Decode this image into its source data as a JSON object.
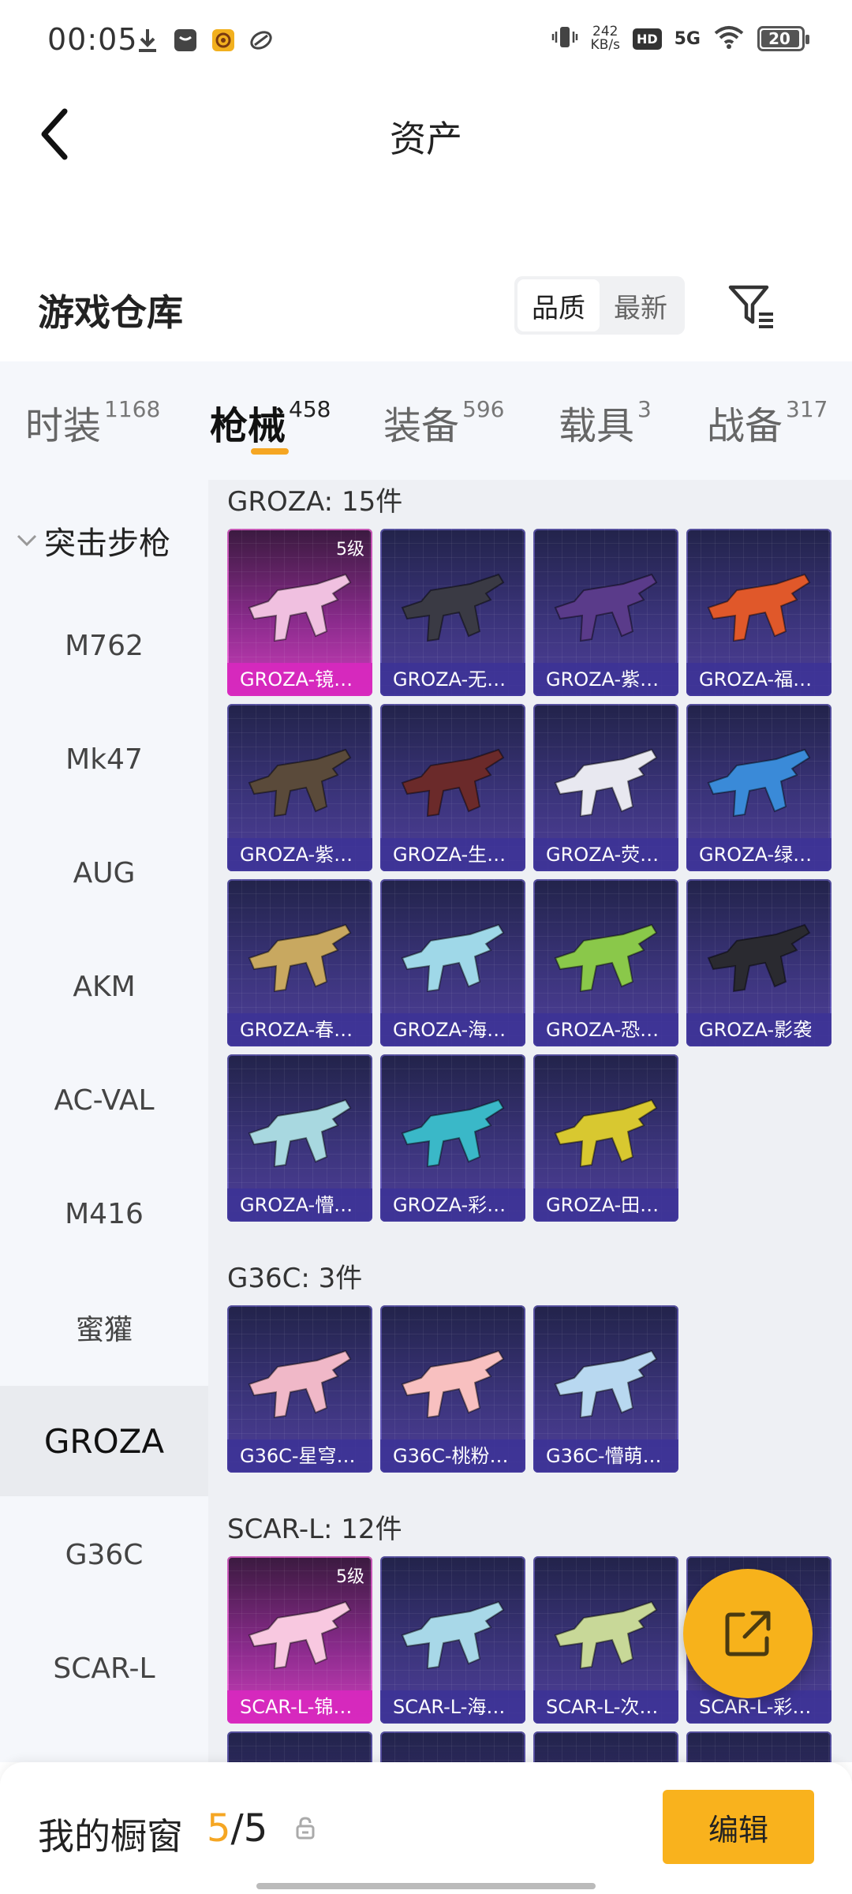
{
  "status": {
    "time": "00:05",
    "speed_value": "242",
    "speed_unit": "KB/s",
    "hd": "HD",
    "network": "5G",
    "battery": "20"
  },
  "header": {
    "title": "资产"
  },
  "warehouse": {
    "title": "游戏仓库",
    "sort_options": [
      "品质",
      "最新"
    ],
    "active_sort": "品质"
  },
  "tabs": [
    {
      "label": "时装",
      "count": "1168"
    },
    {
      "label": "枪械",
      "count": "458"
    },
    {
      "label": "装备",
      "count": "596"
    },
    {
      "label": "载具",
      "count": "3"
    },
    {
      "label": "战备",
      "count": "317"
    }
  ],
  "sidebar": {
    "category": "突击步枪",
    "items": [
      "M762",
      "Mk47",
      "AUG",
      "AKM",
      "AC-VAL",
      "M416",
      "蜜獾",
      "GROZA",
      "G36C",
      "SCAR-L"
    ],
    "active": "GROZA"
  },
  "groups": [
    {
      "title": "GROZA: 15件",
      "items": [
        {
          "name": "GROZA-镜…",
          "level": "5级",
          "color": "#f0c0e0"
        },
        {
          "name": "GROZA-无…",
          "color": "#3a3a44"
        },
        {
          "name": "GROZA-紫…",
          "color": "#5a3b8a"
        },
        {
          "name": "GROZA-福…",
          "color": "#e0582a"
        },
        {
          "name": "GROZA-紫…",
          "color": "#5a4a3a"
        },
        {
          "name": "GROZA-生…",
          "color": "#6b2a2a"
        },
        {
          "name": "GROZA-荧…",
          "color": "#e8e8f0"
        },
        {
          "name": "GROZA-绿…",
          "color": "#3a8ad8"
        },
        {
          "name": "GROZA-春…",
          "color": "#c8a860"
        },
        {
          "name": "GROZA-海…",
          "color": "#9fd8e8"
        },
        {
          "name": "GROZA-恐…",
          "color": "#8ac84a"
        },
        {
          "name": "GROZA-影袭",
          "color": "#2a2a30"
        },
        {
          "name": "GROZA-懵…",
          "color": "#a8d8e0"
        },
        {
          "name": "GROZA-彩…",
          "color": "#3ab8c8"
        },
        {
          "name": "GROZA-田…",
          "color": "#d8c830"
        }
      ]
    },
    {
      "title": "G36C: 3件",
      "items": [
        {
          "name": "G36C-星穹…",
          "color": "#f0b8c8"
        },
        {
          "name": "G36C-桃粉…",
          "color": "#f8c0c0"
        },
        {
          "name": "G36C-懵萌…",
          "color": "#b8d8f0"
        }
      ]
    },
    {
      "title": "SCAR-L: 12件",
      "items": [
        {
          "name": "SCAR-L-锦…",
          "level": "5级",
          "color": "#f8c8e0"
        },
        {
          "name": "SCAR-L-海…",
          "color": "#a8d8e8"
        },
        {
          "name": "SCAR-L-次…",
          "color": "#c8d898"
        },
        {
          "name": "SCAR-L-彩…",
          "color": "#d8b8e8"
        }
      ]
    }
  ],
  "showcase": {
    "label": "我的橱窗",
    "current": "5",
    "total": "/5",
    "edit_label": "编辑"
  }
}
